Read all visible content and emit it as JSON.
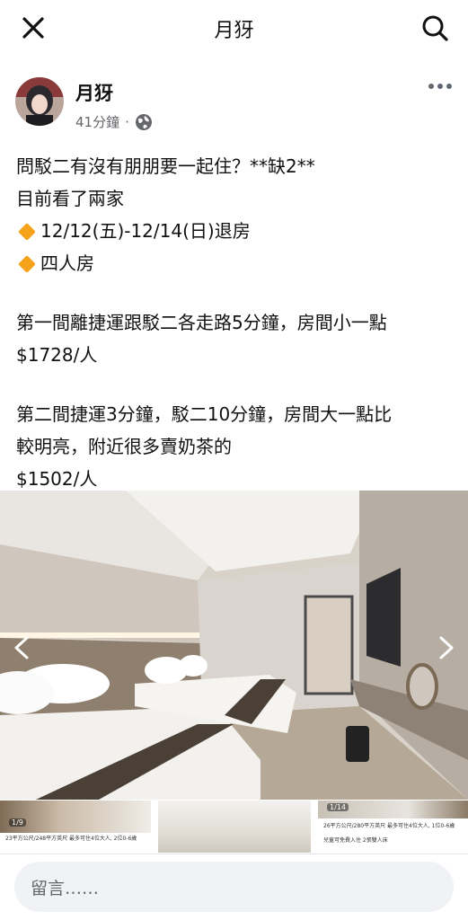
{
  "header": {
    "title": "月犽",
    "close_icon": "close-icon",
    "search_icon": "search-icon"
  },
  "post": {
    "author": "月犽",
    "time": "41分鐘",
    "separator": "·",
    "privacy_icon": "globe-icon",
    "more_icon": "more-icon",
    "lines": [
      "問駁二有沒有朋朋要一起住？**缺2**",
      "目前看了兩家",
      "12/12(五)-12/14(日)退房",
      "四人房",
      "第一間離捷運跟駁二各走路5分鐘，房間小一點",
      "$1728/人",
      "第二間捷運3分鐘，駁二10分鐘，房間大一點比",
      "較明亮，附近很多賣奶茶的",
      "$1502/人"
    ],
    "bullet_icon": "orange-diamond-icon"
  },
  "gallery": {
    "prev_icon": "chevron-left-icon",
    "next_icon": "chevron-right-icon",
    "thumbs": [
      {
        "count": "1/9",
        "caption": "23平方公尺/248平方英尺    最多可住4位大人, 2位0-6歲"
      },
      {
        "count": "",
        "caption": ""
      },
      {
        "count": "1/14",
        "caption": "26平方公尺/280平方英尺    最多可住4位大人, 1位0-6歲"
      }
    ],
    "thumb3_caption2": "兒童可免費入住    2張雙人床"
  },
  "comment": {
    "placeholder": "留言……"
  },
  "colors": {
    "accent_diamond": "#f7a21b",
    "text": "#111111",
    "muted": "#65676b",
    "input_bg": "#f0f2f5"
  }
}
